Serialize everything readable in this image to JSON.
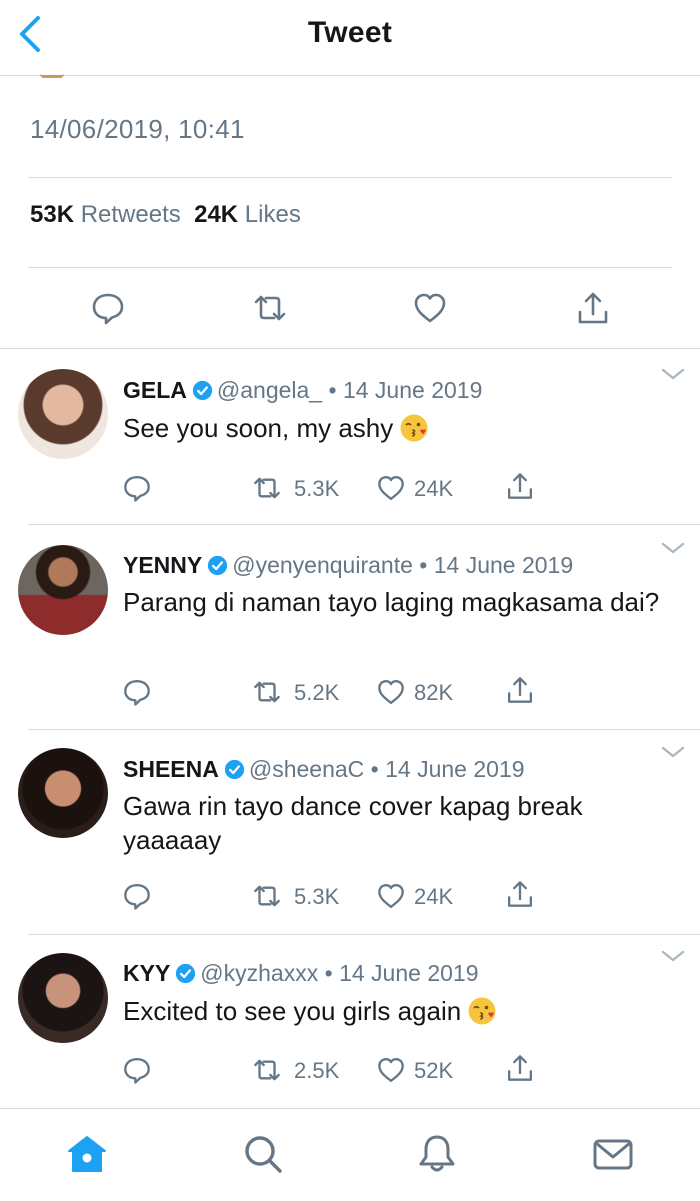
{
  "header": {
    "title": "Tweet",
    "back_label": "back"
  },
  "tweet": {
    "timestamp": "14/06/2019, 10:41",
    "retweets_count": "53K",
    "retweets_label": "Retweets",
    "likes_count": "24K",
    "likes_label": "Likes"
  },
  "colors": {
    "accent": "#1da1f2",
    "text": "#14171a",
    "muted": "#657786",
    "divider": "#d9dde0",
    "icon": "#657786"
  },
  "replies": [
    {
      "name": "GELA",
      "handle": "@angela_",
      "date": "14 June 2019",
      "separator": "•",
      "text": "See you soon, my ashy",
      "emoji": "kissing-face-emoji",
      "retweets": "5.3K",
      "likes": "24K"
    },
    {
      "name": "YENNY",
      "handle": "@yenyenquirante",
      "date": "14 June 2019",
      "separator": "•",
      "text": "Parang di naman tayo laging magkasama dai?",
      "emoji": "",
      "retweets": "5.2K",
      "likes": "82K"
    },
    {
      "name": "SHEENA",
      "handle": "@sheenaC",
      "date": "14 June 2019",
      "separator": "•",
      "text": "Gawa rin tayo dance cover kapag break yaaaaay",
      "emoji": "",
      "retweets": "5.3K",
      "likes": "24K"
    },
    {
      "name": "KYY",
      "handle": "@kyzhaxxx",
      "date": "14 June 2019",
      "separator": "•",
      "text": "Excited to see you girls again",
      "emoji": "kissing-face-emoji",
      "retweets": "2.5K",
      "likes": "52K"
    }
  ],
  "tabbar": {
    "items": [
      "home-icon",
      "search-icon",
      "notifications-icon",
      "messages-icon"
    ],
    "active": "home-icon"
  }
}
